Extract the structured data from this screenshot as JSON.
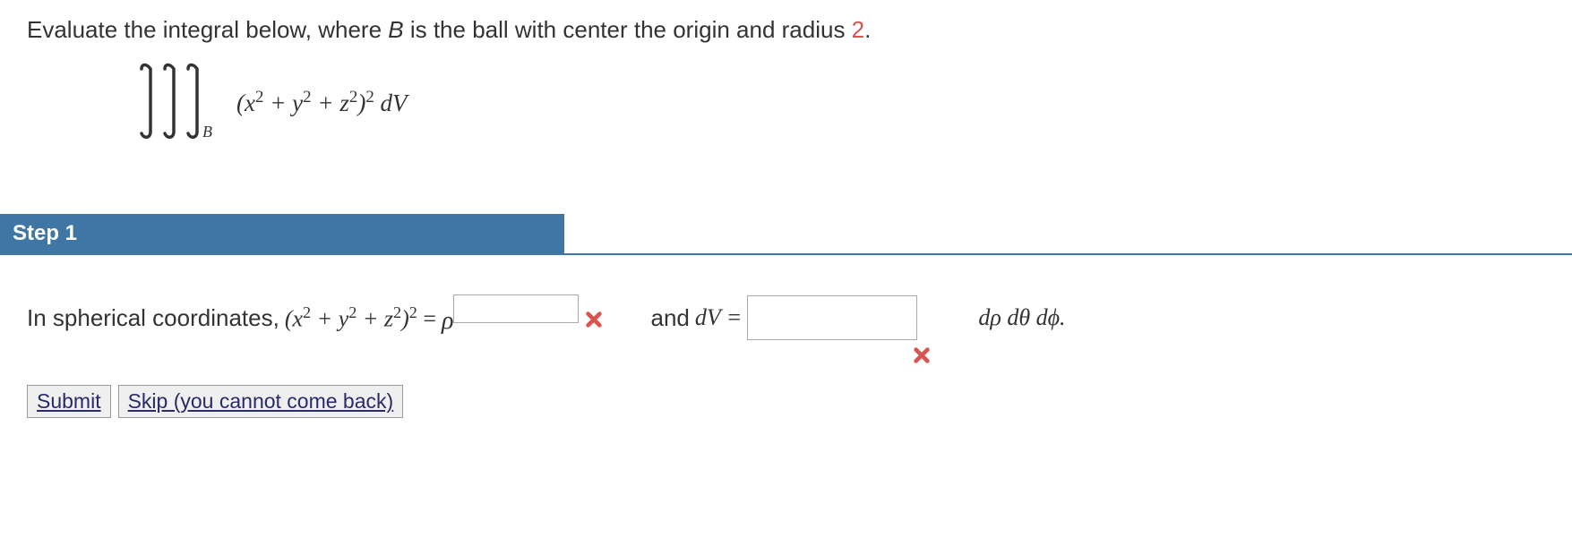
{
  "prompt": {
    "before_B": "Evaluate the integral below, where ",
    "B": "B",
    "after_B": " is the ball with center the origin and radius ",
    "radius": "2",
    "period": "."
  },
  "integral": {
    "region": "B",
    "expr_x2": "x",
    "expr_plus1": " + ",
    "expr_y2": "y",
    "expr_plus2": " + ",
    "expr_z2": "z",
    "expr_outer_paren_close": ")",
    "dV": " dV"
  },
  "step": {
    "label": "Step 1"
  },
  "step1": {
    "intro": "In spherical coordinates,  ",
    "expr_open": "(",
    "x": "x",
    "plus1": " + ",
    "y": "y",
    "plus2": " + ",
    "z": "z",
    "expr_close": ")",
    "equals_rho": " = ",
    "rho": "ρ",
    "and_dV": "and ",
    "dV_eq": "dV = ",
    "diffs": "dρ dθ dϕ.",
    "input1_value": "",
    "input2_value": ""
  },
  "buttons": {
    "submit": "Submit",
    "skip": "Skip (you cannot come back)"
  },
  "icons": {
    "wrong": "wrong-icon"
  }
}
